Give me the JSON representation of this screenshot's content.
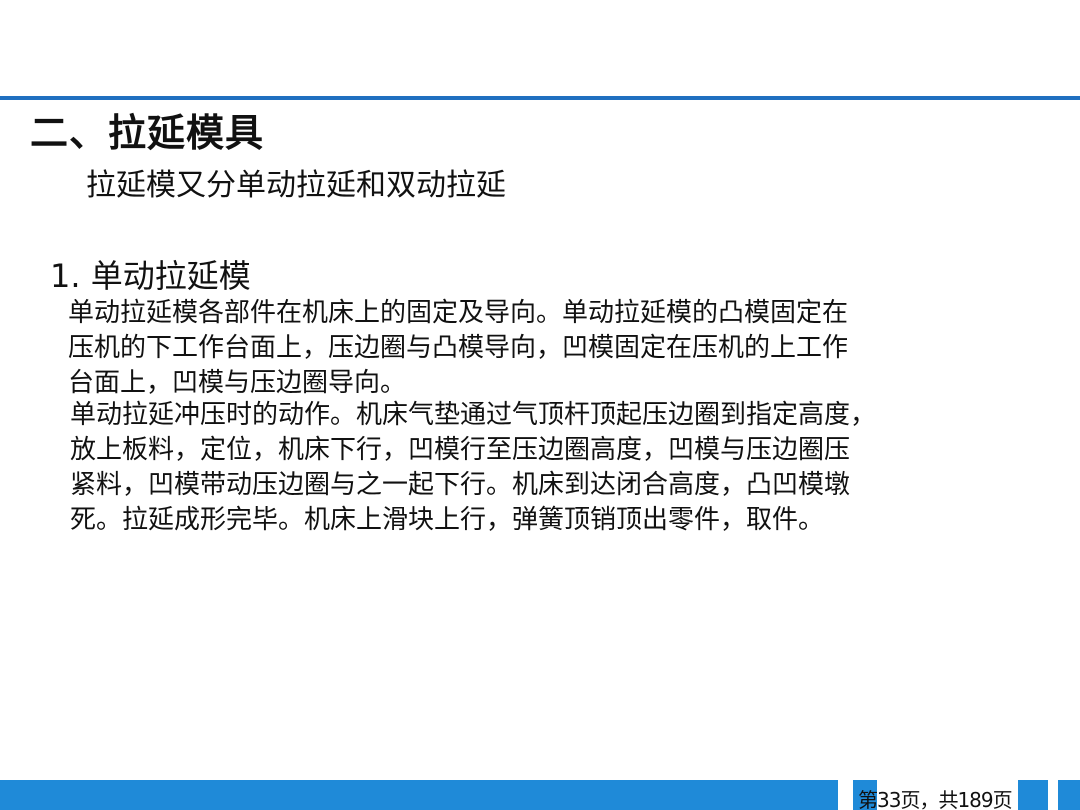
{
  "slide": {
    "heading": "二、拉延模具",
    "subheading": "拉延模又分单动拉延和双动拉延",
    "section_title": "1. 单动拉延模",
    "paragraphs": [
      {
        "lines": [
          "单动拉延模各部件在机床上的固定及导向。单动拉延模的凸模固定在",
          "压机的下工作台面上，压边圈与凸模导向，凹模固定在压机的上工作",
          "台面上，凹模与压边圈导向。"
        ]
      },
      {
        "lines": [
          "单动拉延冲压时的动作。机床气垫通过气顶杆顶起压边圈到指定高度，",
          "放上板料，定位，机床下行，凹模行至压边圈高度，凹模与压边圈压",
          "紧料，凹模带动压边圈与之一起下行。机床到达闭合高度，凸凹模墩",
          "死。拉延成形完毕。机床上滑块上行，弹簧顶销顶出零件，取件。"
        ]
      }
    ],
    "page_counter": "第33页，共189页"
  },
  "colors": {
    "accent_rule": "#1f6fc0",
    "footer_bar": "#1f8ad8",
    "text": "#111111",
    "background": "#ffffff"
  }
}
